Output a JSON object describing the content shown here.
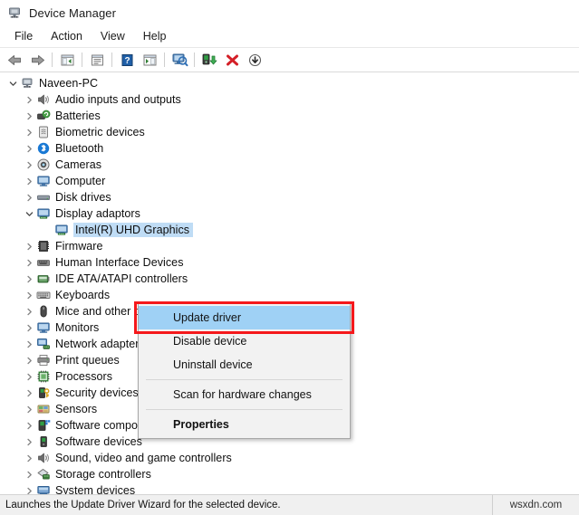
{
  "window": {
    "title": "Device Manager",
    "app_icon": "device-manager-icon"
  },
  "menubar": {
    "items": [
      {
        "label": "File",
        "name": "menu-file"
      },
      {
        "label": "Action",
        "name": "menu-action"
      },
      {
        "label": "View",
        "name": "menu-view"
      },
      {
        "label": "Help",
        "name": "menu-help"
      }
    ]
  },
  "toolbar": {
    "buttons": [
      {
        "icon": "back-arrow-icon",
        "name": "toolbar-back"
      },
      {
        "icon": "forward-arrow-icon",
        "name": "toolbar-forward"
      },
      {
        "icon": "show-hide-console-tree-icon",
        "name": "toolbar-console-tree"
      },
      {
        "icon": "properties-icon",
        "name": "toolbar-properties"
      },
      {
        "icon": "help-icon",
        "name": "toolbar-help"
      },
      {
        "icon": "show-hide-action-pane-icon",
        "name": "toolbar-action-pane"
      },
      {
        "icon": "scan-hardware-changes-icon",
        "name": "toolbar-scan-hardware"
      },
      {
        "icon": "update-driver-icon",
        "name": "toolbar-update-driver"
      },
      {
        "icon": "uninstall-device-icon",
        "name": "toolbar-uninstall-device"
      },
      {
        "icon": "disable-device-icon",
        "name": "toolbar-disable-device"
      }
    ]
  },
  "tree": {
    "root": {
      "label": "Naveen-PC",
      "icon": "computer-root-icon",
      "expanded": true
    },
    "items": [
      {
        "label": "Audio inputs and outputs",
        "icon": "speaker-icon",
        "expanded": false,
        "selected": false
      },
      {
        "label": "Batteries",
        "icon": "battery-icon",
        "expanded": false,
        "selected": false
      },
      {
        "label": "Biometric devices",
        "icon": "fingerprint-icon",
        "expanded": false,
        "selected": false
      },
      {
        "label": "Bluetooth",
        "icon": "bluetooth-icon",
        "expanded": false,
        "selected": false
      },
      {
        "label": "Cameras",
        "icon": "camera-icon",
        "expanded": false,
        "selected": false
      },
      {
        "label": "Computer",
        "icon": "monitor-icon",
        "expanded": false,
        "selected": false
      },
      {
        "label": "Disk drives",
        "icon": "disk-drive-icon",
        "expanded": false,
        "selected": false
      },
      {
        "label": "Display adaptors",
        "icon": "display-adapter-icon",
        "expanded": true,
        "selected": false
      },
      {
        "label": "Intel(R) UHD Graphics",
        "icon": "display-adapter-icon",
        "expanded": false,
        "selected": true,
        "child": true
      },
      {
        "label": "Firmware",
        "icon": "firmware-chip-icon",
        "expanded": false,
        "selected": false
      },
      {
        "label": "Human Interface Devices",
        "icon": "hid-icon",
        "expanded": false,
        "selected": false
      },
      {
        "label": "IDE ATA/ATAPI controllers",
        "icon": "ide-controller-icon",
        "expanded": false,
        "selected": false
      },
      {
        "label": "Keyboards",
        "icon": "keyboard-icon",
        "expanded": false,
        "selected": false
      },
      {
        "label": "Mice and other pointing devices",
        "icon": "mouse-icon",
        "expanded": false,
        "selected": false
      },
      {
        "label": "Monitors",
        "icon": "monitor-icon",
        "expanded": false,
        "selected": false
      },
      {
        "label": "Network adapters",
        "icon": "network-adapter-icon",
        "expanded": false,
        "selected": false
      },
      {
        "label": "Print queues",
        "icon": "printer-icon",
        "expanded": false,
        "selected": false
      },
      {
        "label": "Processors",
        "icon": "processor-icon",
        "expanded": false,
        "selected": false
      },
      {
        "label": "Security devices",
        "icon": "security-key-icon",
        "expanded": false,
        "selected": false
      },
      {
        "label": "Sensors",
        "icon": "sensor-icon",
        "expanded": false,
        "selected": false
      },
      {
        "label": "Software components",
        "icon": "software-component-icon",
        "expanded": false,
        "selected": false
      },
      {
        "label": "Software devices",
        "icon": "software-device-icon",
        "expanded": false,
        "selected": false
      },
      {
        "label": "Sound, video and game controllers",
        "icon": "speaker-icon",
        "expanded": false,
        "selected": false
      },
      {
        "label": "Storage controllers",
        "icon": "storage-controller-icon",
        "expanded": false,
        "selected": false
      },
      {
        "label": "System devices",
        "icon": "system-device-icon",
        "expanded": false,
        "selected": false
      }
    ]
  },
  "context_menu": {
    "items": [
      {
        "label": "Update driver",
        "name": "ctx-update-driver",
        "highlighted": true,
        "bold": false,
        "separator_after": false
      },
      {
        "label": "Disable device",
        "name": "ctx-disable-device",
        "highlighted": false,
        "bold": false,
        "separator_after": false
      },
      {
        "label": "Uninstall device",
        "name": "ctx-uninstall-device",
        "highlighted": false,
        "bold": false,
        "separator_after": true
      },
      {
        "label": "Scan for hardware changes",
        "name": "ctx-scan-hardware-changes",
        "highlighted": false,
        "bold": false,
        "separator_after": true
      },
      {
        "label": "Properties",
        "name": "ctx-properties",
        "highlighted": false,
        "bold": true,
        "separator_after": false
      }
    ]
  },
  "statusbar": {
    "text": "Launches the Update Driver Wizard for the selected device.",
    "watermark": "wsxdn.com"
  },
  "colors": {
    "highlight_blue": "#9fd1f5",
    "selection_blue": "#bfdcf5",
    "annotation_red": "#f5181b",
    "window_chrome": "#f0f0f0"
  }
}
